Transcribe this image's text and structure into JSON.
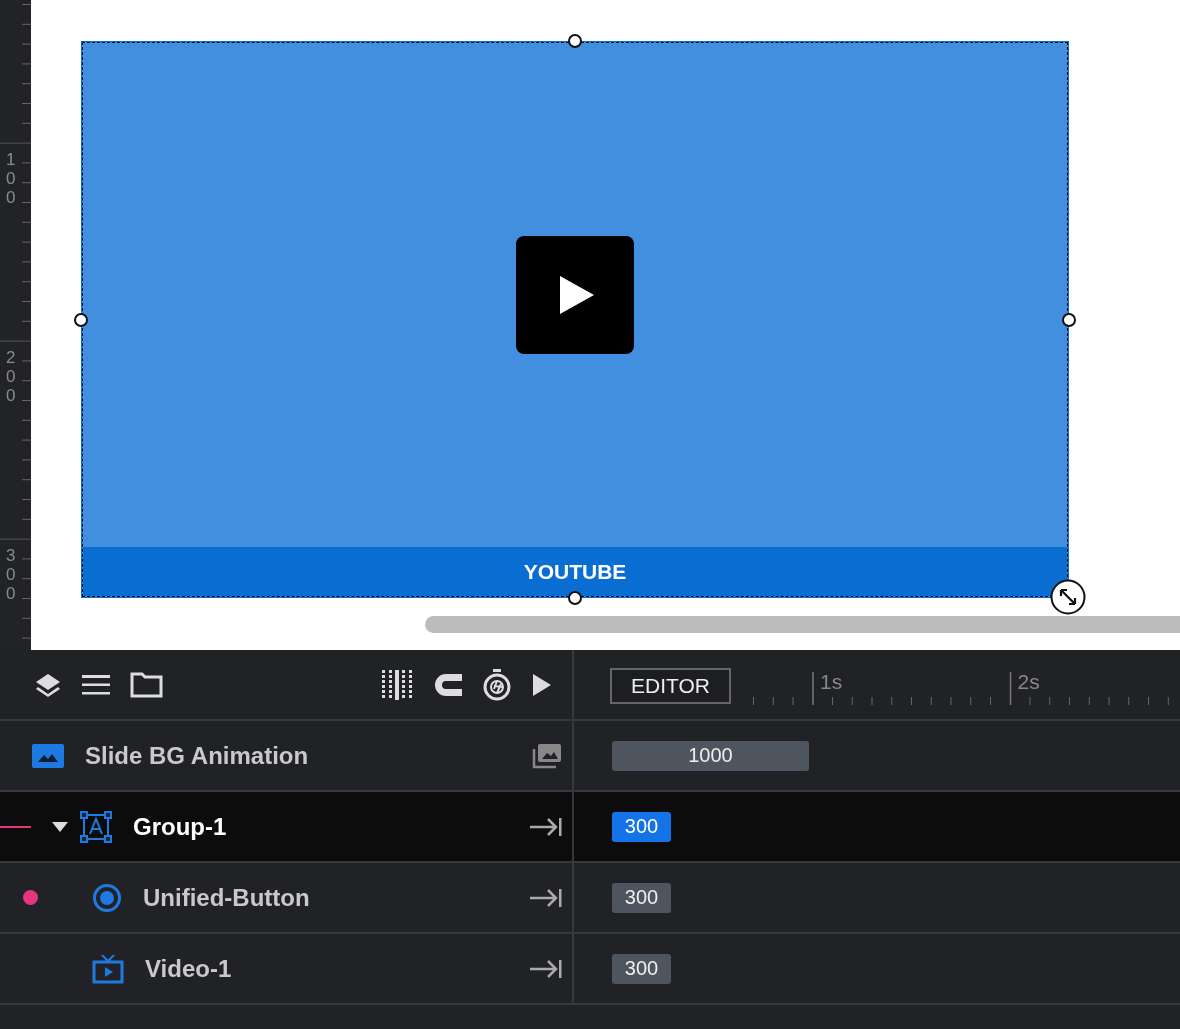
{
  "ruler": {
    "labels": [
      "100",
      "200",
      "300"
    ]
  },
  "stage": {
    "element": {
      "caption": "YOUTUBE",
      "selected": true
    }
  },
  "timeline": {
    "editor_button": "EDITOR",
    "time_labels": [
      "1s",
      "2s"
    ]
  },
  "background_row": {
    "name": "Slide BG Animation",
    "duration": "1000"
  },
  "layers": [
    {
      "kind": "group",
      "name": "Group-1",
      "duration": "300",
      "selected": true,
      "expanded": true,
      "marked": true,
      "children": [
        {
          "kind": "button",
          "name": "Unified-Button",
          "duration": "300",
          "selected": false,
          "marked": true
        },
        {
          "kind": "video",
          "name": "Video-1",
          "duration": "300",
          "selected": false,
          "marked": false
        }
      ]
    }
  ]
}
